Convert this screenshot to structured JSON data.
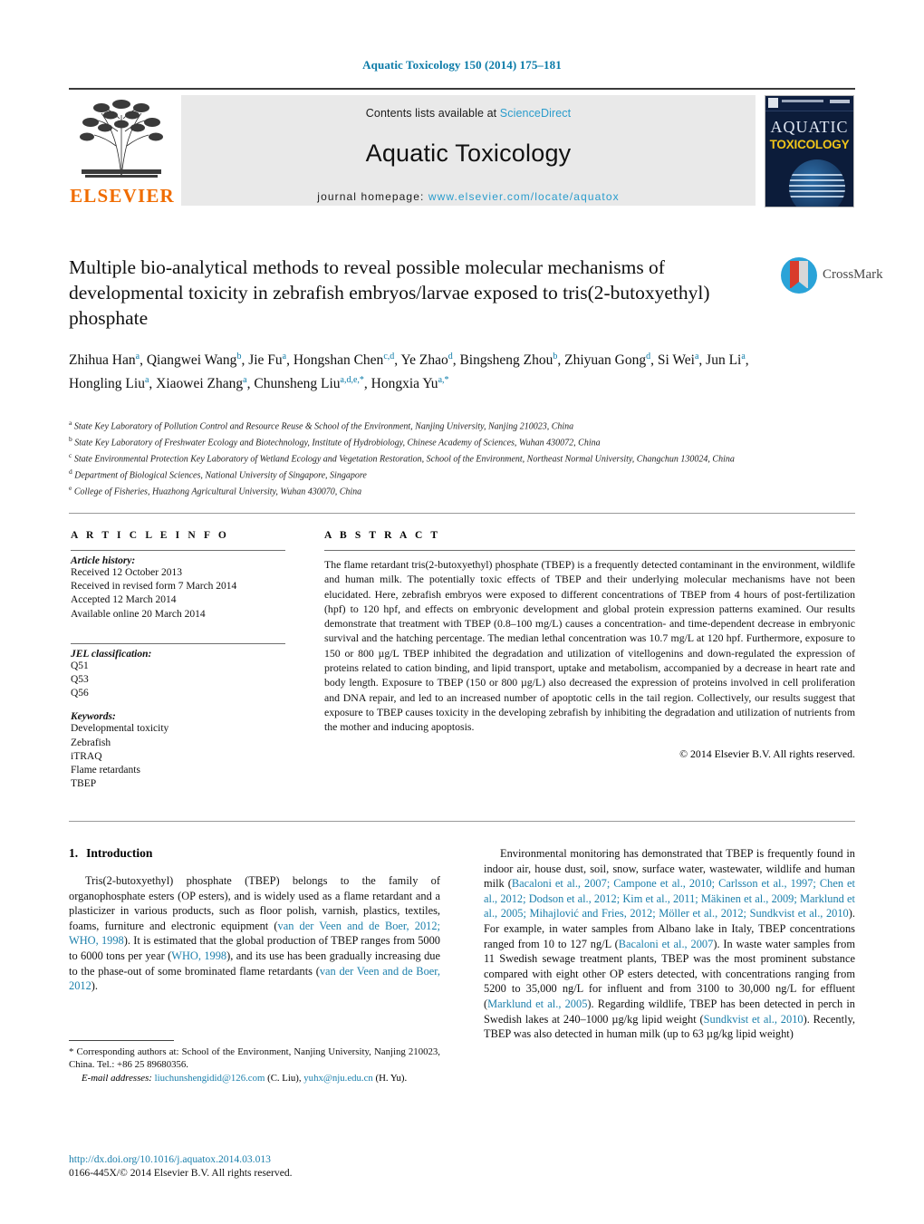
{
  "running_head": "Aquatic Toxicology 150 (2014) 175–181",
  "masthead": {
    "contents_prefix": "Contents lists available at ",
    "sciencedirect": "ScienceDirect",
    "journal_title": "Aquatic Toxicology",
    "homepage_prefix": "journal homepage: ",
    "homepage_url": "www.elsevier.com/locate/aquatox",
    "elsevier_wordmark": "ELSEVIER",
    "cover_line1": "AQUATIC",
    "cover_line2": "TOXICOLOGY"
  },
  "crossmark": {
    "label": "CrossMark"
  },
  "article": {
    "title": "Multiple bio-analytical methods to reveal possible molecular mechanisms of developmental toxicity in zebrafish embryos/larvae exposed to tris(2-butoxyethyl) phosphate",
    "authors": [
      {
        "name": "Zhihua Han",
        "sup": "a"
      },
      {
        "name": "Qiangwei Wang",
        "sup": "b"
      },
      {
        "name": "Jie Fu",
        "sup": "a"
      },
      {
        "name": "Hongshan Chen",
        "sup": "c,d"
      },
      {
        "name": "Ye Zhao",
        "sup": "d"
      },
      {
        "name": "Bingsheng Zhou",
        "sup": "b"
      },
      {
        "name": "Zhiyuan Gong",
        "sup": "d"
      },
      {
        "name": "Si Wei",
        "sup": "a"
      },
      {
        "name": "Jun Li",
        "sup": "a"
      },
      {
        "name": "Hongling Liu",
        "sup": "a"
      },
      {
        "name": "Xiaowei Zhang",
        "sup": "a"
      },
      {
        "name": "Chunsheng Liu",
        "sup": "a,d,e,*"
      },
      {
        "name": "Hongxia Yu",
        "sup": "a,*"
      }
    ],
    "affiliations": [
      {
        "mark": "a",
        "text": "State Key Laboratory of Pollution Control and Resource Reuse & School of the Environment, Nanjing University, Nanjing 210023, China"
      },
      {
        "mark": "b",
        "text": "State Key Laboratory of Freshwater Ecology and Biotechnology, Institute of Hydrobiology, Chinese Academy of Sciences, Wuhan 430072, China"
      },
      {
        "mark": "c",
        "text": "State Environmental Protection Key Laboratory of Wetland Ecology and Vegetation Restoration, School of the Environment, Northeast Normal University, Changchun 130024, China"
      },
      {
        "mark": "d",
        "text": "Department of Biological Sciences, National University of Singapore, Singapore"
      },
      {
        "mark": "e",
        "text": "College of Fisheries, Huazhong Agricultural University, Wuhan 430070, China"
      }
    ]
  },
  "article_info": {
    "heading": "A R T I C L E   I N F O",
    "history_label": "Article history:",
    "history": [
      "Received 12 October 2013",
      "Received in revised form 7 March 2014",
      "Accepted 12 March 2014",
      "Available online 20 March 2014"
    ],
    "jel_label": "JEL classification:",
    "jel": [
      "Q51",
      "Q53",
      "Q56"
    ],
    "keywords_label": "Keywords:",
    "keywords": [
      "Developmental toxicity",
      "Zebrafish",
      "iTRAQ",
      "Flame retardants",
      "TBEP"
    ]
  },
  "abstract": {
    "heading": "A B S T R A C T",
    "text": "The flame retardant tris(2-butoxyethyl) phosphate (TBEP) is a frequently detected contaminant in the environment, wildlife and human milk. The potentially toxic effects of TBEP and their underlying molecular mechanisms have not been elucidated. Here, zebrafish embryos were exposed to different concentrations of TBEP from 4 hours of post-fertilization (hpf) to 120 hpf, and effects on embryonic development and global protein expression patterns examined. Our results demonstrate that treatment with TBEP (0.8–100 mg/L) causes a concentration- and time-dependent decrease in embryonic survival and the hatching percentage. The median lethal concentration was 10.7 mg/L at 120 hpf. Furthermore, exposure to 150 or 800 µg/L TBEP inhibited the degradation and utilization of vitellogenins and down-regulated the expression of proteins related to cation binding, and lipid transport, uptake and metabolism, accompanied by a decrease in heart rate and body length. Exposure to TBEP (150 or 800 µg/L) also decreased the expression of proteins involved in cell proliferation and DNA repair, and led to an increased number of apoptotic cells in the tail region. Collectively, our results suggest that exposure to TBEP causes toxicity in the developing zebrafish by inhibiting the degradation and utilization of nutrients from the mother and inducing apoptosis.",
    "copyright": "© 2014 Elsevier B.V. All rights reserved."
  },
  "introduction": {
    "number": "1.",
    "heading": "Introduction",
    "left_paragraph_parts": [
      {
        "t": "Tris(2-butoxyethyl) phosphate (TBEP) belongs to the family of organophosphate esters (OP esters), and is widely used as a flame retardant and a plasticizer in various products, such as floor polish, varnish, plastics, textiles, foams, furniture and electronic equipment (",
        "ref": false
      },
      {
        "t": "van der Veen and de Boer, 2012; WHO, 1998",
        "ref": true
      },
      {
        "t": "). It is estimated that the global production of TBEP ranges from 5000 to 6000 tons per year (",
        "ref": false
      },
      {
        "t": "WHO, 1998",
        "ref": true
      },
      {
        "t": "), and its use has been gradually increasing due to the phase-out of some brominated flame retardants (",
        "ref": false
      },
      {
        "t": "van der Veen and de Boer, 2012",
        "ref": true
      },
      {
        "t": ").",
        "ref": false
      }
    ],
    "right_paragraph_parts": [
      {
        "t": "Environmental monitoring has demonstrated that TBEP is frequently found in indoor air, house dust, soil, snow, surface water, wastewater, wildlife and human milk (",
        "ref": false
      },
      {
        "t": "Bacaloni et al., 2007; Campone et al., 2010; Carlsson et al., 1997; Chen et al., 2012; Dodson et al., 2012; Kim et al., 2011; Mäkinen et al., 2009; Marklund et al., 2005; Mihajlović and Fries, 2012; Möller et al., 2012; Sundkvist et al., 2010",
        "ref": true
      },
      {
        "t": "). For example, in water samples from Albano lake in Italy, TBEP concentrations ranged from 10 to 127 ng/L (",
        "ref": false
      },
      {
        "t": "Bacaloni et al., 2007",
        "ref": true
      },
      {
        "t": "). In waste water samples from 11 Swedish sewage treatment plants, TBEP was the most prominent substance compared with eight other OP esters detected, with concentrations ranging from 5200 to 35,000 ng/L for influent and from 3100 to 30,000 ng/L for effluent (",
        "ref": false
      },
      {
        "t": "Marklund et al., 2005",
        "ref": true
      },
      {
        "t": "). Regarding wildlife, TBEP has been detected in perch in Swedish lakes at 240–1000 µg/kg lipid weight (",
        "ref": false
      },
      {
        "t": "Sundkvist et al., 2010",
        "ref": true
      },
      {
        "t": "). Recently, TBEP was also detected in human milk (up to 63 µg/kg lipid weight)",
        "ref": false
      }
    ]
  },
  "footnotes": {
    "corresponding": "* Corresponding authors at: School of the Environment, Nanjing University, Nanjing 210023, China. Tel.: +86 25 89680356.",
    "email_label": "E-mail addresses:",
    "email1": "liuchunshengidid@126.com",
    "email1_owner": "(C. Liu),",
    "email2": "yuhx@nju.edu.cn",
    "email2_owner": "(H. Yu)."
  },
  "doi_block": {
    "doi": "http://dx.doi.org/10.1016/j.aquatox.2014.03.013",
    "issn": "0166-445X/© 2014 Elsevier B.V. All rights reserved."
  },
  "colors": {
    "link": "#1b7fab",
    "running_head": "#0b7ba8",
    "sciencedirect": "#2a9ccc",
    "elsevier_orange": "#f06c00"
  }
}
